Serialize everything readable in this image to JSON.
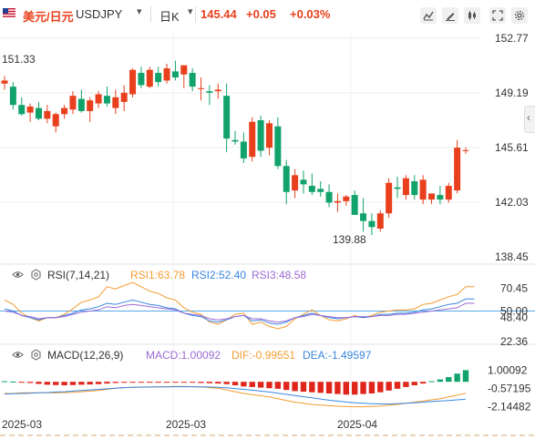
{
  "header": {
    "symbol_cn": "美元/日元",
    "symbol": "USDJPY",
    "timeframe": "日K",
    "price": "145.44",
    "change": "+0.05",
    "change_pct": "+0.03%",
    "up_color": "#e8401c",
    "down_color": "#11a36b",
    "icons": [
      "indicator-icon",
      "draw-icon",
      "candle-type-icon",
      "fullscreen-icon",
      "settings-icon"
    ]
  },
  "rsi_header": {
    "label": "RSI(7,14,21)",
    "rsi1": "RSI1:63.78",
    "rsi2": "RSI2:52.40",
    "rsi3": "RSI3:48.58",
    "colors": {
      "rsi1": "#f39c32",
      "rsi2": "#3a86e0",
      "rsi3": "#9b6ad6"
    }
  },
  "macd_header": {
    "label": "MACD(12,26,9)",
    "macd": "MACD:1.00092",
    "dif": "DIF:-0.99551",
    "dea": "DEA:-1.49597",
    "colors": {
      "macd": "#9b6ad6",
      "dif": "#f39c32",
      "dea": "#3a86e0"
    }
  },
  "chart_data": [
    {
      "type": "candlestick",
      "title": "USDJPY 日K",
      "y_ticks": [
        "152.77",
        "149.19",
        "145.61",
        "142.03",
        "138.45"
      ],
      "ylim": [
        138.45,
        152.77
      ],
      "annotations": [
        {
          "text": "151.33",
          "value": 151.33
        },
        {
          "text": "139.88",
          "value": 139.88
        }
      ],
      "x_ticks": [
        "2025-03",
        "2025-03",
        "2025-04"
      ],
      "ohlc": [
        [
          149.8,
          150.3,
          149.4,
          150.0
        ],
        [
          149.6,
          149.9,
          148.1,
          148.4
        ],
        [
          148.4,
          148.9,
          147.7,
          147.8
        ],
        [
          147.9,
          148.5,
          147.3,
          148.3
        ],
        [
          148.2,
          148.6,
          147.4,
          147.5
        ],
        [
          147.5,
          148.4,
          147.2,
          148.0
        ],
        [
          147.0,
          147.9,
          146.6,
          147.8
        ],
        [
          147.8,
          148.4,
          147.5,
          148.2
        ],
        [
          148.1,
          149.3,
          147.8,
          149.0
        ],
        [
          148.8,
          149.4,
          147.9,
          148.0
        ],
        [
          148.0,
          148.9,
          147.3,
          148.7
        ],
        [
          148.5,
          149.3,
          148.2,
          149.1
        ],
        [
          149.0,
          149.6,
          148.3,
          148.5
        ],
        [
          148.2,
          149.4,
          147.8,
          148.9
        ],
        [
          148.6,
          149.7,
          148.0,
          149.2
        ],
        [
          149.1,
          150.8,
          148.9,
          150.7
        ],
        [
          150.5,
          150.9,
          149.5,
          149.7
        ],
        [
          149.6,
          150.9,
          149.5,
          150.7
        ],
        [
          150.5,
          150.9,
          149.6,
          149.9
        ],
        [
          150.0,
          151.1,
          149.8,
          150.8
        ],
        [
          150.6,
          151.3,
          150.0,
          150.2
        ],
        [
          150.4,
          151.0,
          149.5,
          151.0
        ],
        [
          150.5,
          150.8,
          149.3,
          149.6
        ],
        [
          149.5,
          150.2,
          148.7,
          149.5
        ],
        [
          149.3,
          149.7,
          148.4,
          149.2
        ],
        [
          149.3,
          149.8,
          148.8,
          149.4
        ],
        [
          149.0,
          149.8,
          145.3,
          146.2
        ],
        [
          146.1,
          146.7,
          145.8,
          146.0
        ],
        [
          146.0,
          146.6,
          144.6,
          144.9
        ],
        [
          145.0,
          147.6,
          144.7,
          147.3
        ],
        [
          147.4,
          147.7,
          145.0,
          145.4
        ],
        [
          145.6,
          147.4,
          145.1,
          147.2
        ],
        [
          147.0,
          147.6,
          144.2,
          144.4
        ],
        [
          144.4,
          144.8,
          141.9,
          142.7
        ],
        [
          142.8,
          144.2,
          142.3,
          143.8
        ],
        [
          143.5,
          144.1,
          142.6,
          143.2
        ],
        [
          143.1,
          143.9,
          142.5,
          142.7
        ],
        [
          142.9,
          143.4,
          142.4,
          142.7
        ],
        [
          142.7,
          143.2,
          141.7,
          142.0
        ],
        [
          142.0,
          142.6,
          141.4,
          142.1
        ],
        [
          142.1,
          142.5,
          141.8,
          142.4
        ],
        [
          142.5,
          142.8,
          141.2,
          141.2
        ],
        [
          141.3,
          142.3,
          140.1,
          140.8
        ],
        [
          140.8,
          141.3,
          139.88,
          140.4
        ],
        [
          140.3,
          141.5,
          140.1,
          141.3
        ],
        [
          141.3,
          143.6,
          141.0,
          143.3
        ],
        [
          143.0,
          143.7,
          142.3,
          142.9
        ],
        [
          142.5,
          143.8,
          142.2,
          143.6
        ],
        [
          143.4,
          143.8,
          142.2,
          142.5
        ],
        [
          142.2,
          143.8,
          141.9,
          143.5
        ],
        [
          142.2,
          142.6,
          141.9,
          142.6
        ],
        [
          142.5,
          143.1,
          141.9,
          142.2
        ],
        [
          142.2,
          143.3,
          142.0,
          143.1
        ],
        [
          142.8,
          146.1,
          142.6,
          145.6
        ],
        [
          145.4,
          145.6,
          145.2,
          145.44
        ]
      ]
    },
    {
      "type": "line",
      "title": "RSI(7,14,21)",
      "y_ticks": [
        "70.45",
        "50.00",
        "48.40",
        "22.36"
      ],
      "ylim": [
        22.36,
        76.0
      ],
      "series": [
        {
          "name": "RSI1",
          "values": [
            60,
            56,
            48,
            44,
            41,
            44,
            44,
            47,
            52,
            58,
            60,
            63,
            72,
            70,
            73,
            76,
            72,
            68,
            66,
            62,
            60,
            53,
            49,
            47,
            40,
            38,
            42,
            47,
            48,
            38,
            40,
            36,
            34,
            36,
            43,
            47,
            51,
            46,
            42,
            41,
            43,
            46,
            44,
            46,
            49,
            50,
            51,
            51,
            52,
            56,
            57,
            60,
            63,
            65,
            72,
            72
          ]
        },
        {
          "name": "RSI2",
          "values": [
            52,
            50,
            46,
            44,
            42,
            44,
            44,
            46,
            48,
            51,
            52,
            54,
            57,
            56,
            58,
            60,
            58,
            56,
            55,
            53,
            52,
            48,
            46,
            45,
            41,
            40,
            42,
            45,
            46,
            41,
            42,
            39,
            38,
            40,
            44,
            46,
            48,
            46,
            44,
            43,
            44,
            45,
            44,
            45,
            47,
            47,
            48,
            48,
            49,
            51,
            52,
            54,
            56,
            57,
            61,
            61
          ]
        },
        {
          "name": "RSI3",
          "values": [
            50,
            49,
            46,
            45,
            43,
            44,
            44,
            45,
            47,
            49,
            50,
            51,
            54,
            53,
            55,
            56,
            55,
            54,
            53,
            52,
            51,
            48,
            47,
            46,
            43,
            42,
            43,
            45,
            46,
            43,
            43,
            41,
            40,
            41,
            44,
            45,
            47,
            46,
            45,
            44,
            44,
            45,
            45,
            45,
            46,
            46,
            47,
            47,
            48,
            49,
            50,
            51,
            52,
            53,
            57,
            57
          ]
        }
      ]
    },
    {
      "type": "bar",
      "title": "MACD(12,26,9)",
      "y_ticks": [
        "1.00092",
        "-0.57195",
        "-2.14482"
      ],
      "ylim": [
        -2.8,
        1.5
      ],
      "hist": [
        0.05,
        0.02,
        -0.05,
        -0.1,
        -0.18,
        -0.25,
        -0.28,
        -0.3,
        -0.28,
        -0.25,
        -0.23,
        -0.2,
        -0.15,
        -0.1,
        -0.08,
        -0.05,
        -0.04,
        -0.03,
        -0.02,
        -0.02,
        -0.03,
        -0.05,
        -0.07,
        -0.1,
        -0.12,
        -0.15,
        -0.2,
        -0.3,
        -0.4,
        -0.45,
        -0.5,
        -0.55,
        -0.6,
        -0.7,
        -0.8,
        -0.85,
        -0.9,
        -0.95,
        -1.0,
        -1.05,
        -1.1,
        -1.1,
        -1.05,
        -1.0,
        -0.9,
        -0.75,
        -0.6,
        -0.45,
        -0.3,
        -0.15,
        0.05,
        0.2,
        0.4,
        0.7,
        1.0
      ],
      "series": [
        {
          "name": "DIF",
          "values": [
            -1.0,
            -1.0,
            -0.95,
            -0.95,
            -0.95,
            -0.95,
            -0.95,
            -0.92,
            -0.9,
            -0.85,
            -0.8,
            -0.75,
            -0.65,
            -0.55,
            -0.5,
            -0.48,
            -0.45,
            -0.45,
            -0.44,
            -0.42,
            -0.4,
            -0.4,
            -0.42,
            -0.45,
            -0.5,
            -0.55,
            -0.7,
            -0.85,
            -1.0,
            -1.1,
            -1.2,
            -1.3,
            -1.45,
            -1.6,
            -1.75,
            -1.85,
            -1.95,
            -2.0,
            -2.05,
            -2.1,
            -2.12,
            -2.14,
            -2.14,
            -2.12,
            -2.1,
            -2.0,
            -1.95,
            -1.85,
            -1.75,
            -1.65,
            -1.55,
            -1.45,
            -1.3,
            -1.15,
            -0.99
          ]
        },
        {
          "name": "DEA",
          "values": [
            -1.05,
            -1.02,
            -1.0,
            -0.98,
            -0.95,
            -0.92,
            -0.88,
            -0.85,
            -0.8,
            -0.75,
            -0.7,
            -0.65,
            -0.6,
            -0.55,
            -0.5,
            -0.48,
            -0.46,
            -0.45,
            -0.44,
            -0.43,
            -0.42,
            -0.42,
            -0.42,
            -0.43,
            -0.45,
            -0.48,
            -0.52,
            -0.58,
            -0.65,
            -0.72,
            -0.8,
            -0.88,
            -0.98,
            -1.08,
            -1.18,
            -1.28,
            -1.38,
            -1.48,
            -1.58,
            -1.66,
            -1.74,
            -1.8,
            -1.85,
            -1.88,
            -1.9,
            -1.9,
            -1.88,
            -1.85,
            -1.8,
            -1.75,
            -1.7,
            -1.65,
            -1.6,
            -1.55,
            -1.49597
          ]
        }
      ]
    }
  ]
}
